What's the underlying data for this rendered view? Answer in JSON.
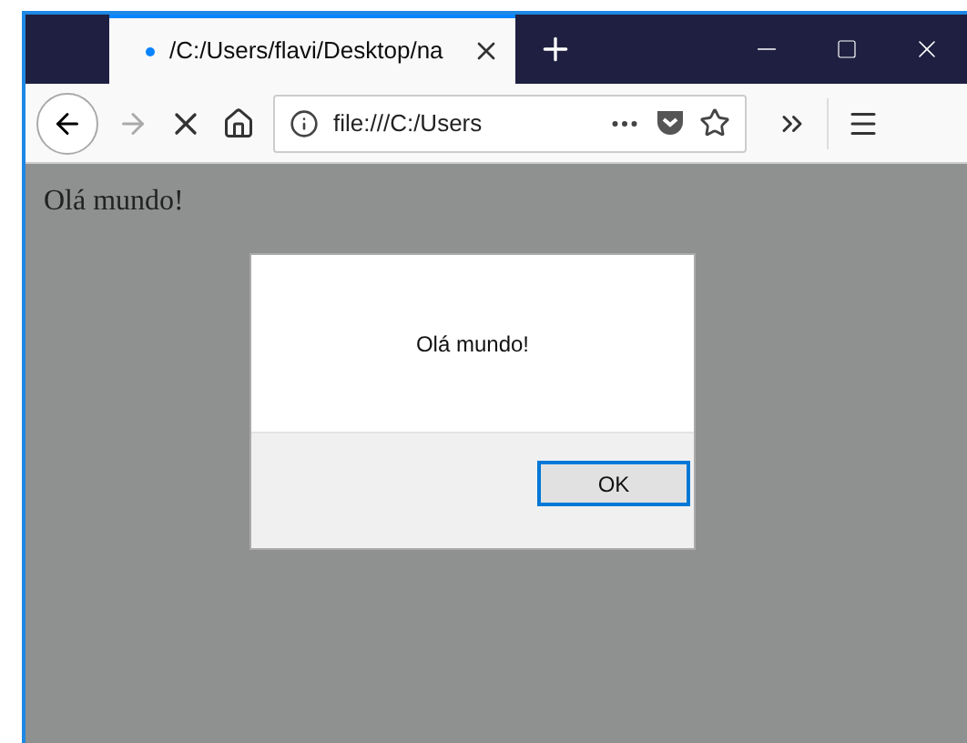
{
  "tab": {
    "title": "/C:/Users/flavi/Desktop/na",
    "loading": true,
    "selected": true
  },
  "toolbar": {
    "address": "file:///C:/Users"
  },
  "page": {
    "text": "Olá mundo!"
  },
  "dialog": {
    "message": "Olá mundo!",
    "buttons": [
      {
        "label": "OK",
        "selected": true
      }
    ]
  }
}
